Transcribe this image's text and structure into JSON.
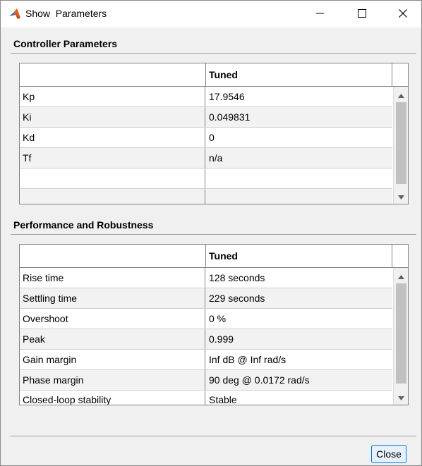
{
  "window": {
    "title": "Show  Parameters",
    "app_icon": "matlab-icon",
    "buttons": {
      "minimize": "minimize-icon",
      "maximize": "maximize-icon",
      "close": "close-icon"
    }
  },
  "controller": {
    "section_title": "Controller Parameters",
    "header": [
      "",
      "Tuned"
    ],
    "rows": [
      [
        "Kp",
        "17.9546"
      ],
      [
        "Ki",
        "0.049831"
      ],
      [
        "Kd",
        "0"
      ],
      [
        "Tf",
        "n/a"
      ],
      [
        "",
        ""
      ],
      [
        "",
        ""
      ]
    ]
  },
  "performance": {
    "section_title": "Performance and Robustness",
    "header": [
      "",
      "Tuned"
    ],
    "rows": [
      [
        "Rise time",
        "128 seconds"
      ],
      [
        "Settling time",
        "229 seconds"
      ],
      [
        "Overshoot",
        "0 %"
      ],
      [
        "Peak",
        "0.999"
      ],
      [
        "Gain margin",
        "Inf dB @ Inf rad/s"
      ],
      [
        "Phase margin",
        "90 deg @ 0.0172 rad/s"
      ],
      [
        "Closed-loop stability",
        "Stable"
      ]
    ]
  },
  "footer": {
    "close_label": "Close"
  },
  "colors": {
    "accent": "#0078d7",
    "scroll_thumb": "#c1c1c1",
    "alt_row": "#f2f2f2"
  }
}
